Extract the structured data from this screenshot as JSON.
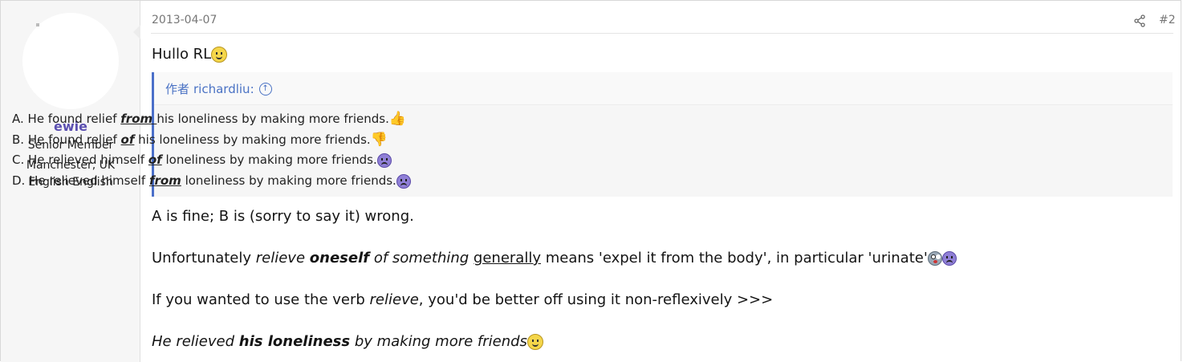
{
  "user": {
    "name": "ewie",
    "title": "Senior Member",
    "location": "Manchester, UK",
    "language": "English English"
  },
  "post": {
    "date": "2013-04-07",
    "number": "#2",
    "greeting": "Hullo RL",
    "quote": {
      "prefix": "作者",
      "author": "richardliu:",
      "lines": [
        {
          "a": "A. He found relief ",
          "em": "from ",
          "b": "his loneliness by making more friends."
        },
        {
          "a": "B. He found relief ",
          "em": "of",
          "b": " his loneliness by making more friends."
        },
        {
          "a": "C. He relieved himself ",
          "em": "of",
          "b": " loneliness by making more friends."
        },
        {
          "a": "D. He relieved himself ",
          "em": "from",
          "b": " loneliness by making more friends."
        }
      ]
    },
    "para1": "A is fine; B is (sorry to say it) wrong.",
    "para2": {
      "t1": "Unfortunately ",
      "t2": "relieve",
      "t3": " ",
      "t4": "oneself",
      "t5": " ",
      "t6": "of something",
      "t7": " ",
      "t8": "generally",
      "t9": " means 'expel it from the body', in particular 'urinate'"
    },
    "para3": {
      "t1": "If you wanted to use the verb ",
      "t2": "relieve",
      "t3": ", you'd be better off using it non-reflexively >>>"
    },
    "para4": {
      "t1": "He relieved ",
      "t2": "his loneliness",
      "t3": " by making more friends"
    }
  },
  "icons": {
    "share": "share-icon",
    "smile": "smile-emoji",
    "thumbs_up": "thumbs-up-emoji",
    "thumbs_down": "thumbs-down-emoji",
    "sad": "sad-emoji",
    "shocked": "shocked-emoji",
    "up_arrow": "arrow-up-circle-icon"
  },
  "colors": {
    "username": "#5b4fb0",
    "quote_border": "#4a6fc9",
    "quote_author": "#4a72c4"
  }
}
